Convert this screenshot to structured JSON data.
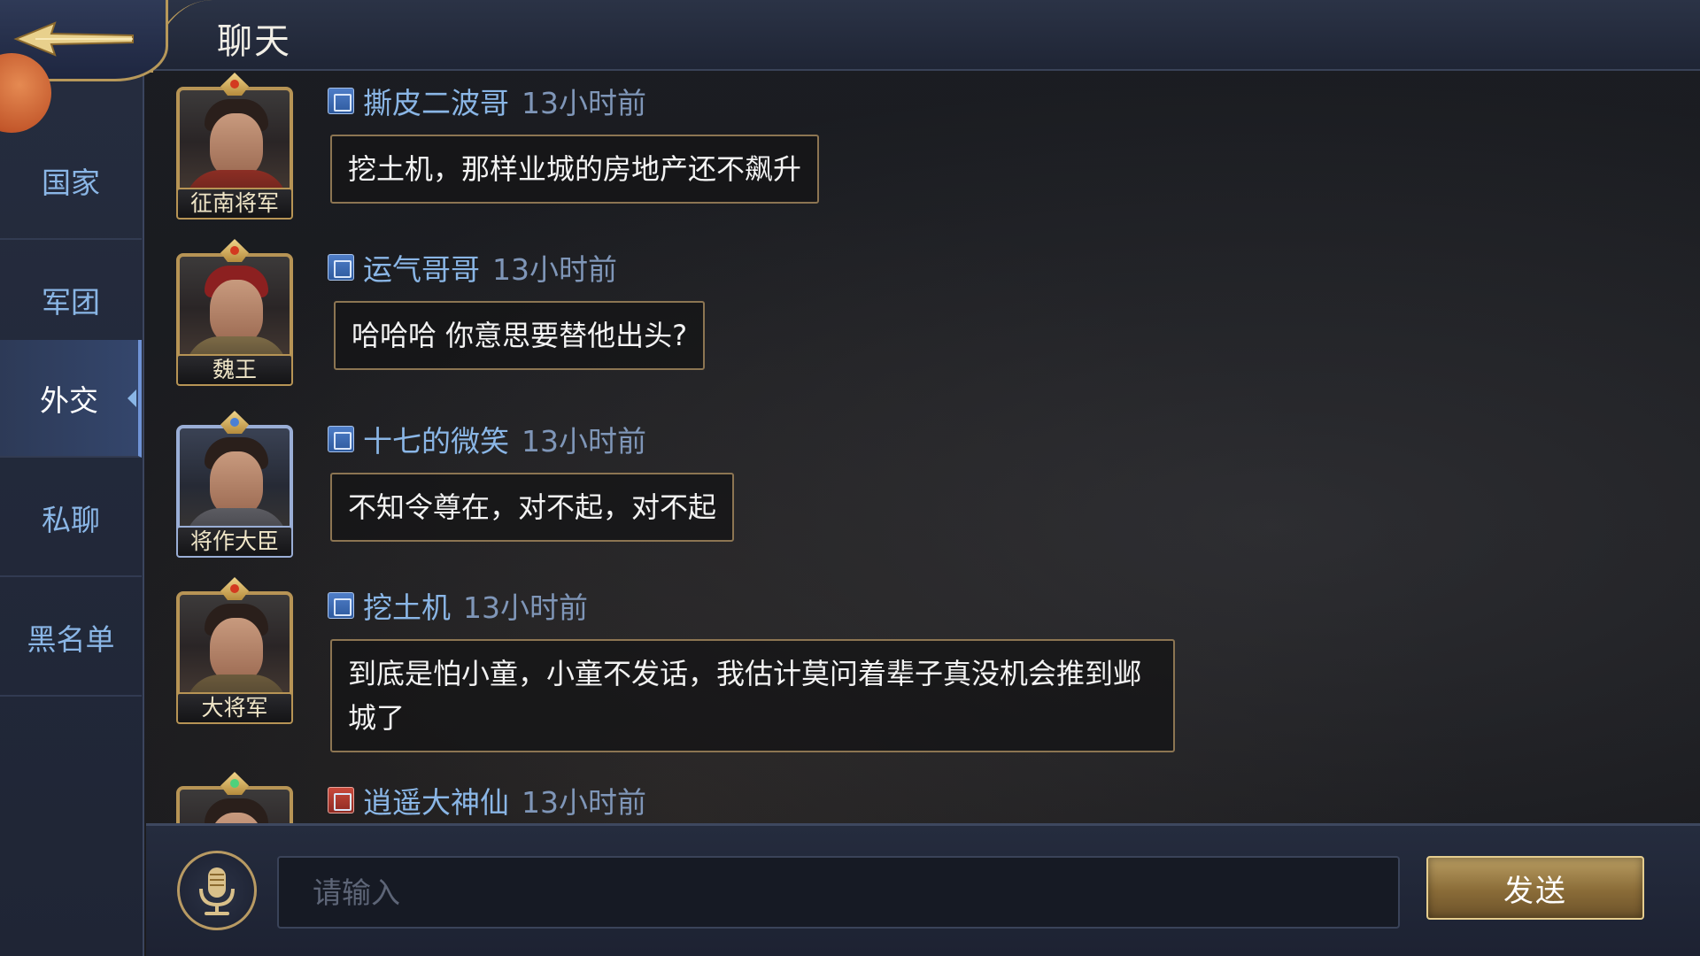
{
  "header": {
    "title": "聊天"
  },
  "sidebar": {
    "tabs": [
      {
        "label": "国家",
        "active": false
      },
      {
        "label": "军团",
        "active": false
      },
      {
        "label": "外交",
        "active": true
      },
      {
        "label": "私聊",
        "active": false
      },
      {
        "label": "黑名单",
        "active": false
      }
    ]
  },
  "messages": [
    {
      "faction": "魏",
      "name": "撕皮二波哥",
      "time": "13小时前",
      "title": "征南将军",
      "text": "挖土机，那样业城的房地产还不飙升"
    },
    {
      "faction": "魏",
      "name": "运气哥哥",
      "time": "13小时前",
      "title": "魏王",
      "text": "哈哈哈 你意思要替他出头?"
    },
    {
      "faction": "魏",
      "name": "十七的微笑",
      "time": "13小时前",
      "title": "将作大臣",
      "text": "不知令尊在，对不起，对不起"
    },
    {
      "faction": "魏",
      "name": "挖土机",
      "time": "13小时前",
      "title": "大将军",
      "text": "到底是怕小童，小童不发话，我估计莫问着辈子真没机会推到邺城了"
    },
    {
      "faction": "吴",
      "name": "逍遥大神仙",
      "time": "13小时前",
      "title": "",
      "text": ""
    }
  ],
  "input": {
    "placeholder": "请输入",
    "value": ""
  },
  "send_button": {
    "label": "发送"
  },
  "colors": {
    "name_blue": "#8ab6e6",
    "gold_border": "#b79455",
    "wei_faction": "#4f7ec8",
    "wu_faction": "#c94a3c"
  },
  "icons": {
    "back": "back-arrow-icon",
    "mic": "microphone-icon"
  }
}
